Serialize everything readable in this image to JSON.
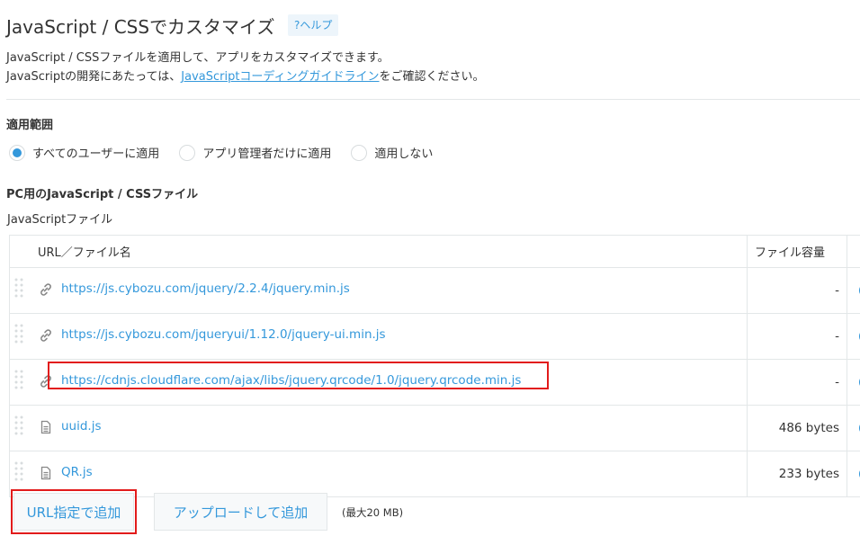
{
  "header": {
    "title": "JavaScript / CSSでカスタマイズ",
    "help_label": "?ヘルプ"
  },
  "description": {
    "line1": "JavaScript / CSSファイルを適用して、アプリをカスタマイズできます。",
    "line2_prefix": "JavaScriptの開発にあたっては、",
    "line2_link": "JavaScriptコーディングガイドライン",
    "line2_suffix": "をご確認ください。"
  },
  "scope": {
    "title": "適用範囲",
    "options": [
      {
        "label": "すべてのユーザーに適用",
        "selected": true
      },
      {
        "label": "アプリ管理者だけに適用",
        "selected": false
      },
      {
        "label": "適用しない",
        "selected": false
      }
    ]
  },
  "pc_files": {
    "title": "PC用のJavaScript / CSSファイル",
    "js_label": "JavaScriptファイル",
    "columns": {
      "url": "URL／ファイル名",
      "size": "ファイル容量"
    },
    "rows": [
      {
        "icon": "link-icon",
        "name": "https://js.cybozu.com/jquery/2.2.4/jquery.min.js",
        "size": "-"
      },
      {
        "icon": "link-icon",
        "name": "https://js.cybozu.com/jqueryui/1.12.0/jquery-ui.min.js",
        "size": "-"
      },
      {
        "icon": "link-icon",
        "name": "https://cdnjs.cloudflare.com/ajax/libs/jquery.qrcode/1.0/jquery.qrcode.min.js",
        "size": "-"
      },
      {
        "icon": "file-icon",
        "name": "uuid.js",
        "size": "486 bytes"
      },
      {
        "icon": "file-icon",
        "name": "QR.js",
        "size": "233 bytes"
      }
    ]
  },
  "actions": {
    "add_url_label": "URL指定で追加",
    "upload_label": "アップロードして追加",
    "max_size": "(最大20 MB)"
  },
  "colors": {
    "accent": "#3498db",
    "highlight": "#e21b1b"
  }
}
